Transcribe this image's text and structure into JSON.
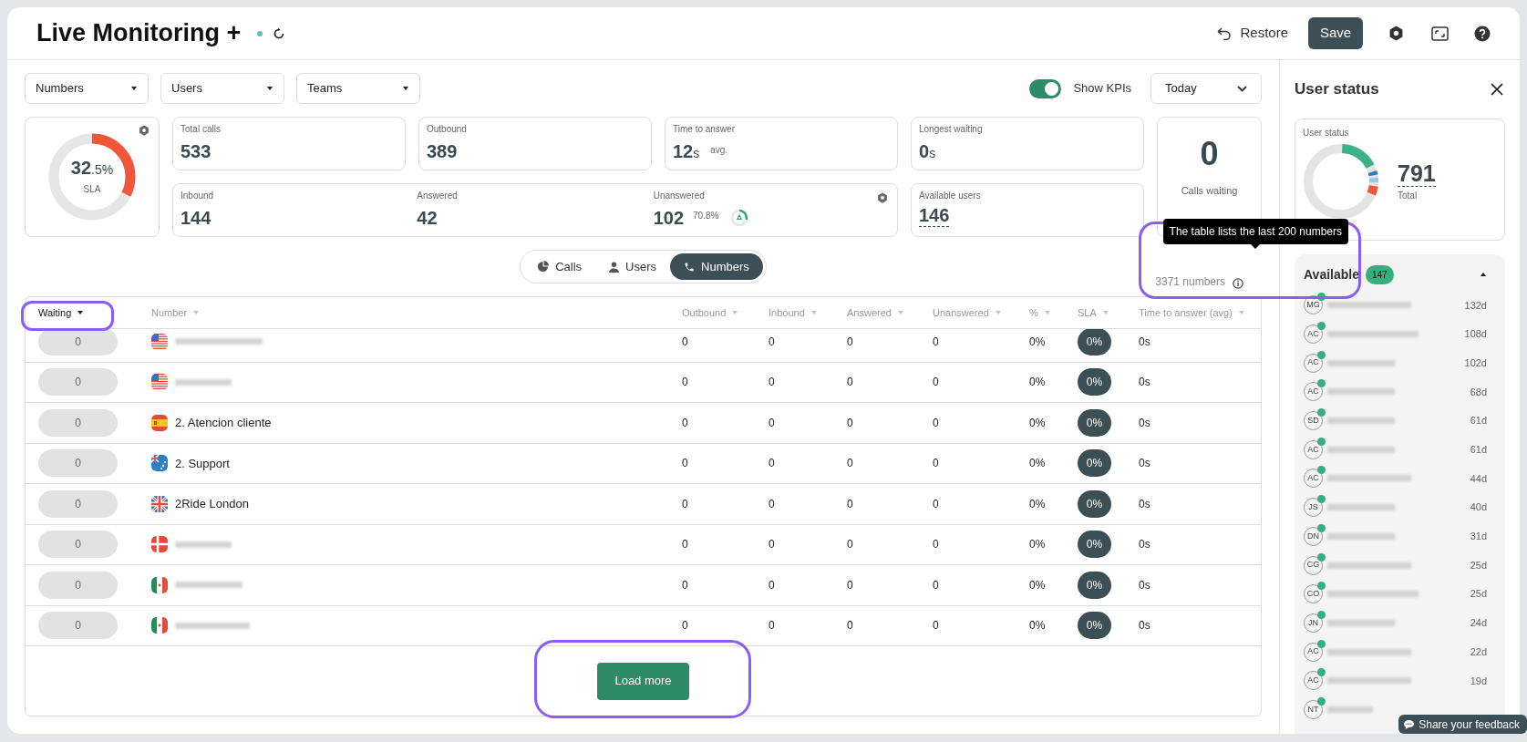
{
  "header": {
    "title": "Live Monitoring +",
    "live": true,
    "restore": "Restore",
    "save": "Save"
  },
  "filters": [
    {
      "label": "Numbers"
    },
    {
      "label": "Users"
    },
    {
      "label": "Teams"
    }
  ],
  "show_kpis": {
    "label": "Show KPIs",
    "on": true
  },
  "period": {
    "value": "Today"
  },
  "sla": {
    "value": "32",
    "fraction": ".5",
    "unit": "%",
    "label": "SLA",
    "level": 0.325
  },
  "kpi_top": [
    {
      "label": "Total calls",
      "value": "533"
    },
    {
      "label": "Outbound",
      "value": "389"
    },
    {
      "label": "Time to answer",
      "value": "12",
      "unit": "s",
      "note": "avg."
    },
    {
      "label": "Longest waiting",
      "value": "0",
      "unit": "s"
    }
  ],
  "kpi_calls": [
    {
      "label": "Inbound",
      "value": "144"
    },
    {
      "label": "Answered",
      "value": "42"
    },
    {
      "label": "Unanswered",
      "value": "102",
      "percent": "70.8%",
      "level": 0.29
    }
  ],
  "available_users": {
    "label": "Available users",
    "value": "146"
  },
  "calls_waiting": {
    "value": "0",
    "label": "Calls waiting"
  },
  "view_tabs": [
    {
      "label": "Calls",
      "kind": "pie",
      "selected": false
    },
    {
      "label": "Users",
      "kind": "user",
      "selected": false
    },
    {
      "label": "Numbers",
      "kind": "phone",
      "selected": true
    }
  ],
  "tooltip": "The table lists the last 200 numbers",
  "count": "3371 numbers",
  "table": {
    "columns": [
      {
        "label": "Waiting",
        "sorted": true
      },
      {
        "label": "Number",
        "sorted": false
      },
      {
        "label": "Outbound",
        "sorted": false
      },
      {
        "label": "Inbound",
        "sorted": false
      },
      {
        "label": "Answered",
        "sorted": false
      },
      {
        "label": "Unanswered",
        "sorted": false
      },
      {
        "label": "%",
        "sorted": false
      },
      {
        "label": "SLA",
        "sorted": false
      },
      {
        "label": "Time to answer (avg)",
        "sorted": false
      }
    ],
    "rows": [
      {
        "waiting": "0",
        "kind": "us",
        "outbound": "0",
        "inbound": "0",
        "answered": "0",
        "unanswered": "0",
        "percent": "0%",
        "sla": "0%",
        "time": "0s"
      },
      {
        "waiting": "0",
        "kind": "us",
        "outbound": "0",
        "inbound": "0",
        "answered": "0",
        "unanswered": "0",
        "percent": "0%",
        "sla": "0%",
        "time": "0s"
      },
      {
        "waiting": "0",
        "kind": "es",
        "name": "2. Atencion cliente",
        "outbound": "0",
        "inbound": "0",
        "answered": "0",
        "unanswered": "0",
        "percent": "0%",
        "sla": "0%",
        "time": "0s"
      },
      {
        "waiting": "0",
        "kind": "au",
        "name": "2. Support",
        "outbound": "0",
        "inbound": "0",
        "answered": "0",
        "unanswered": "0",
        "percent": "0%",
        "sla": "0%",
        "time": "0s"
      },
      {
        "waiting": "0",
        "kind": "gb",
        "name": "2Ride London",
        "outbound": "0",
        "inbound": "0",
        "answered": "0",
        "unanswered": "0",
        "percent": "0%",
        "sla": "0%",
        "time": "0s"
      },
      {
        "waiting": "0",
        "kind": "dk",
        "outbound": "0",
        "inbound": "0",
        "answered": "0",
        "unanswered": "0",
        "percent": "0%",
        "sla": "0%",
        "time": "0s"
      },
      {
        "waiting": "0",
        "kind": "mx",
        "outbound": "0",
        "inbound": "0",
        "answered": "0",
        "unanswered": "0",
        "percent": "0%",
        "sla": "0%",
        "time": "0s"
      },
      {
        "waiting": "0",
        "kind": "mx",
        "outbound": "0",
        "inbound": "0",
        "answered": "0",
        "unanswered": "0",
        "percent": "0%",
        "sla": "0%",
        "time": "0s"
      }
    ]
  },
  "load_more": "Load more",
  "sidebar": {
    "title": "User status",
    "card_label": "User status",
    "total": "791",
    "total_label": "Total",
    "group": {
      "label": "Available",
      "count": "147",
      "expanded": true
    },
    "users": [
      {
        "initials": "MG",
        "days": "132d"
      },
      {
        "initials": "AC",
        "days": "108d"
      },
      {
        "initials": "AC",
        "days": "102d"
      },
      {
        "initials": "AC",
        "days": "68d"
      },
      {
        "initials": "SD",
        "days": "61d"
      },
      {
        "initials": "AC",
        "days": "61d"
      },
      {
        "initials": "AC",
        "days": "44d"
      },
      {
        "initials": "JS",
        "days": "40d"
      },
      {
        "initials": "DN",
        "days": "31d"
      },
      {
        "initials": "CG",
        "days": "25d"
      },
      {
        "initials": "CO",
        "days": "25d"
      },
      {
        "initials": "JN",
        "days": "24d"
      },
      {
        "initials": "AC",
        "days": "22d"
      },
      {
        "initials": "AC",
        "days": "19d"
      },
      {
        "initials": "NT"
      }
    ]
  },
  "feedback": "Share your feedback"
}
